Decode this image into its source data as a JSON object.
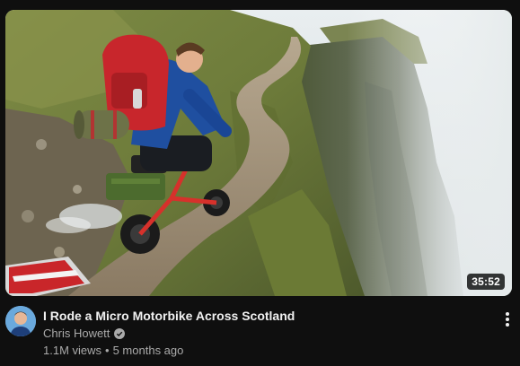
{
  "video": {
    "duration": "35:52",
    "title": "I Rode a Micro Motorbike Across Scotland",
    "channel": "Chris Howett",
    "views": "1.1M views",
    "separator": "•",
    "age": "5 months ago"
  },
  "icons": {
    "verified": "check-circle-icon",
    "menu": "vertical-dots-icon"
  },
  "colors": {
    "background": "#0f0f0f",
    "title_text": "#f1f1f1",
    "secondary_text": "#aaaaaa"
  }
}
